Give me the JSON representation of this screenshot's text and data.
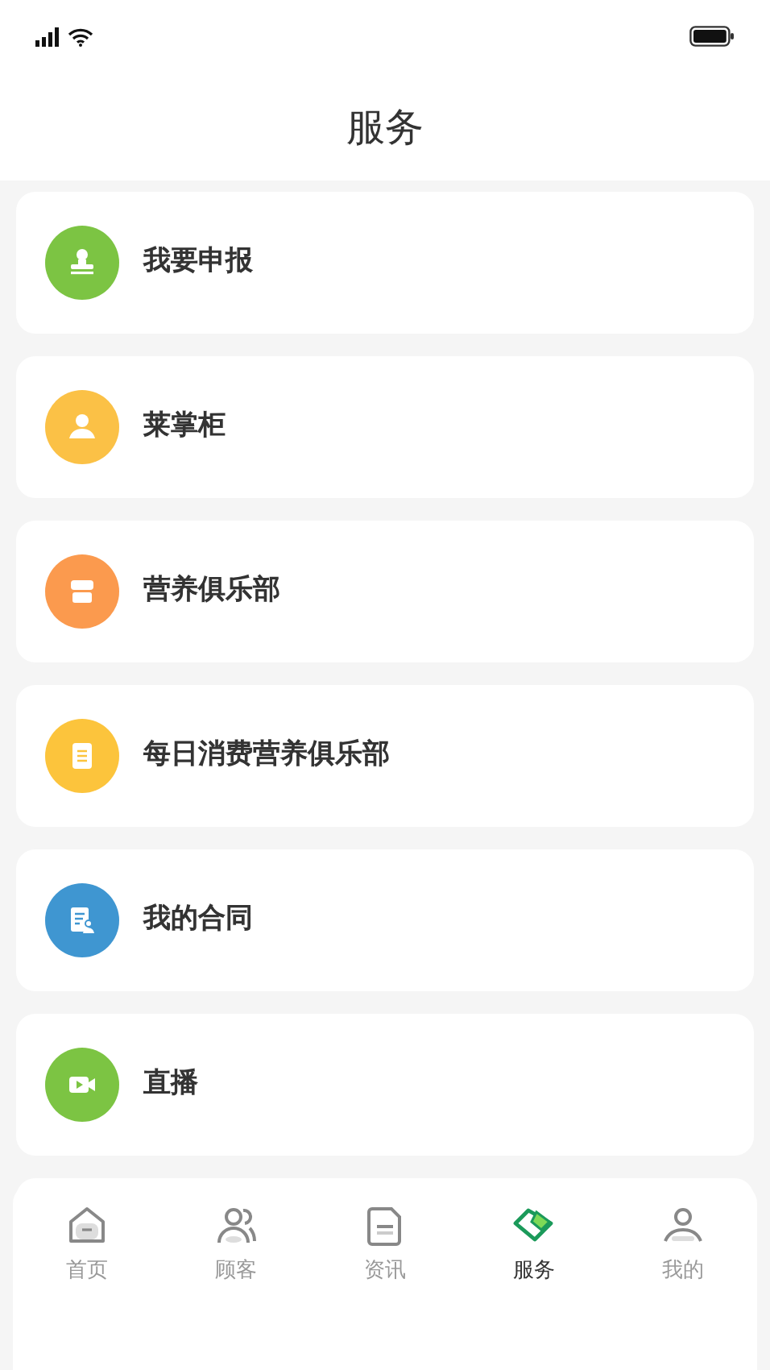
{
  "header": {
    "title": "服务"
  },
  "services": [
    {
      "label": "我要申报",
      "color": "#7cc443"
    },
    {
      "label": "莱掌柜",
      "color": "#fbc146"
    },
    {
      "label": "营养俱乐部",
      "color": "#fb9a4e"
    },
    {
      "label": "每日消费营养俱乐部",
      "color": "#fcc43c"
    },
    {
      "label": "我的合同",
      "color": "#3f96d1"
    },
    {
      "label": "直播",
      "color": "#7cc443"
    }
  ],
  "tab_bar": [
    {
      "label": "首页",
      "selected": false
    },
    {
      "label": "顾客",
      "selected": false
    },
    {
      "label": "资讯",
      "selected": false
    },
    {
      "label": "服务",
      "selected": true
    },
    {
      "label": "我的",
      "selected": false
    }
  ]
}
